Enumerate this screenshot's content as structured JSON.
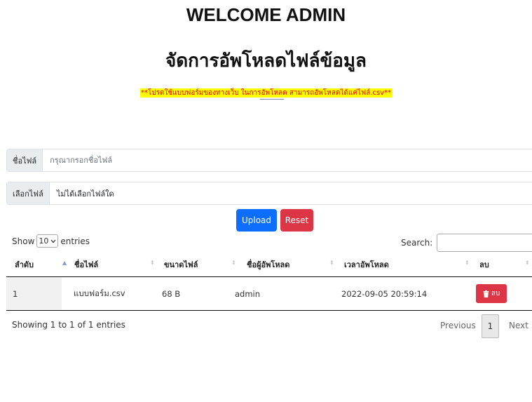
{
  "header": {
    "title": "WELCOME ADMIN",
    "subtitle": "จัดการอัพโหลดไฟล์ข้อมูล",
    "notice": "**โปรดใช้แบบฟอร์มของทางเว็บ ในการอัพโหลด สามารถอัพโหลดได้แค่ไฟล์.csv**"
  },
  "form": {
    "filename_label": "ชื่อไฟล์",
    "filename_placeholder": "กรุณากรอกชื่อไฟล์",
    "choose_label": "เลือกไฟล์",
    "choose_status": "ไม่ได้เลือกไฟล์ใด",
    "upload_label": "Upload",
    "reset_label": "Reset"
  },
  "table_controls": {
    "show_label": "Show",
    "entries_value": "10",
    "entries_label": "entries",
    "search_label": "Search:"
  },
  "table": {
    "columns": [
      "ลำดับ",
      "ชื่อไฟล์",
      "ขนาดไฟล์",
      "ชื่อผู้อัพโหลด",
      "เวลาอัพโหลด",
      "ลบ"
    ],
    "rows": [
      {
        "no": "1",
        "filename": "แบบฟอร์ม.csv",
        "size": "68 B",
        "uploader": "admin",
        "time": "2022-09-05 20:59:14",
        "delete_label": "ลบ"
      }
    ]
  },
  "pagination": {
    "info": "Showing 1 to 1 of 1 entries",
    "previous": "Previous",
    "current_page": "1",
    "next": "Next"
  },
  "colors": {
    "primary": "#0d6efd",
    "danger": "#dc3545",
    "notice_bg": "#ffff00",
    "notice_text": "#e00000"
  }
}
